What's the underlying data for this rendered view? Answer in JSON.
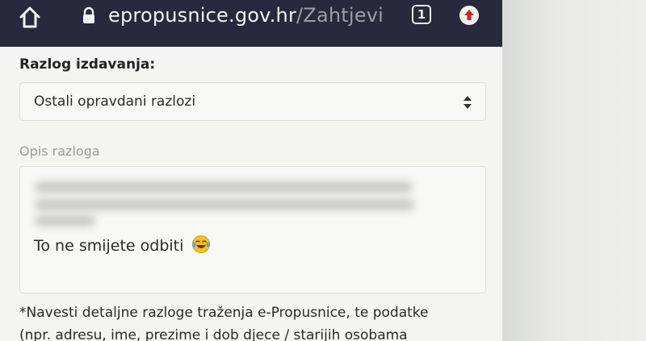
{
  "browser": {
    "url_host": "epropusnice.gov.hr",
    "url_path": "/Zahtjevi",
    "tab_count": "1",
    "icons": {
      "home": "home-icon",
      "lock": "lock-icon",
      "update": "update-icon"
    }
  },
  "form": {
    "reason_label": "Razlog izdavanja:",
    "reason_selected": "Ostali opravdani razlozi",
    "description_label": "Opis razloga",
    "description_text": "To ne smijete odbiti",
    "description_emoji": "face-with-tears-of-joy",
    "hint_line1": "*Navesti detaljne razloge traženja e-Propusnice, te podatke",
    "hint_line2": "(npr. adresu, ime, prezime i dob djece / starijih osobama"
  },
  "colors": {
    "url_bar": "#262a3c",
    "page_background": "#f4f4f1",
    "update_badge": "#c8262b"
  }
}
